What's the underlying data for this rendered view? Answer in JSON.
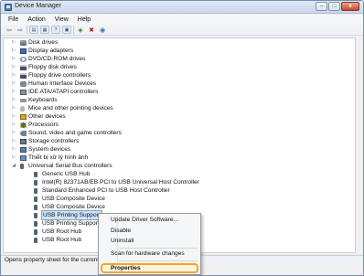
{
  "window": {
    "title": "Device Manager",
    "controls": {
      "minimize": "–",
      "maximize": "□",
      "close": "x"
    }
  },
  "menubar": {
    "items": [
      "File",
      "Action",
      "View",
      "Help"
    ]
  },
  "toolbar": {
    "icons": [
      "back-arrow-icon",
      "forward-arrow-icon",
      "device-list-icon",
      "properties-icon",
      "help-icon",
      "computer-icon",
      "update-driver-icon",
      "uninstall-icon",
      "scan-hardware-icon"
    ],
    "glyphs": {
      "back": "⇦",
      "forward": "⇨"
    }
  },
  "tree": {
    "items": [
      {
        "label": "Disk drives",
        "icon": "disk-drive-icon"
      },
      {
        "label": "Display adapters",
        "icon": "display-adapter-icon"
      },
      {
        "label": "DVD/CD-ROM drives",
        "icon": "dvd-icon"
      },
      {
        "label": "Floppy disk drives",
        "icon": "floppy-icon"
      },
      {
        "label": "Floppy drive controllers",
        "icon": "floppy-controller-icon"
      },
      {
        "label": "Human Interface Devices",
        "icon": "hid-icon"
      },
      {
        "label": "IDE ATA/ATAPI controllers",
        "icon": "ide-icon"
      },
      {
        "label": "Keyboards",
        "icon": "keyboard-icon"
      },
      {
        "label": "Mice and other pointing devices",
        "icon": "mouse-icon"
      },
      {
        "label": "Other devices",
        "icon": "other-devices-icon"
      },
      {
        "label": "Processors",
        "icon": "processor-icon"
      },
      {
        "label": "Sound, video and game controllers",
        "icon": "sound-icon"
      },
      {
        "label": "Storage controllers",
        "icon": "storage-icon"
      },
      {
        "label": "System devices",
        "icon": "system-icon"
      },
      {
        "label": "Thiết bị xử lý hình ảnh",
        "icon": "imaging-device-icon"
      },
      {
        "label": "Universal Serial Bus controllers",
        "icon": "usb-controller-icon"
      },
      {
        "label": "Generic USB Hub",
        "icon": "usb-icon"
      },
      {
        "label": "Intel(R) 82371AB/EB PCI to USB Universal Host Controller",
        "icon": "usb-icon"
      },
      {
        "label": "Standard Enhanced PCI to USB Host Controller",
        "icon": "usb-icon"
      },
      {
        "label": "USB Composite Device",
        "icon": "usb-icon"
      },
      {
        "label": "USB Composite Device",
        "icon": "usb-icon"
      },
      {
        "label": "USB Printing Support",
        "icon": "usb-icon"
      },
      {
        "label": "USB Printing Support",
        "icon": "usb-icon"
      },
      {
        "label": "USB Root Hub",
        "icon": "usb-icon"
      },
      {
        "label": "USB Root Hub",
        "icon": "usb-icon"
      }
    ],
    "expander_collapsed": "▷",
    "expander_expanded": "◢"
  },
  "context_menu": {
    "items": [
      {
        "label": "Update Driver Software..."
      },
      {
        "label": "Disable"
      },
      {
        "label": "Uninstall"
      },
      {
        "label": "Scan for hardware changes"
      },
      {
        "label": "Properties"
      }
    ],
    "highlight_color": "#f5a623"
  },
  "statusbar": {
    "text": "Opens property sheet for the current"
  },
  "colors": {
    "selection": "#cde3f8",
    "highlight": "#f5a623"
  }
}
